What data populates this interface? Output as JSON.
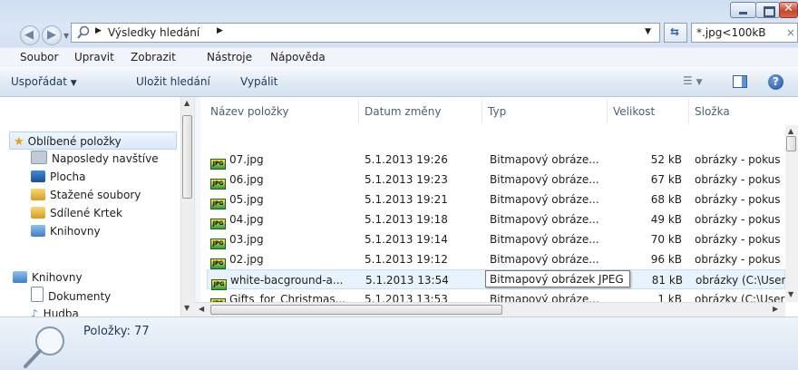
{
  "window": {
    "breadcrumb": "Výsledky hledání",
    "search_value": "*.jpg<100kB"
  },
  "menu": [
    "Soubor",
    "Upravit",
    "Zobrazit",
    "Nástroje",
    "Nápověda"
  ],
  "commands": {
    "organize": "Uspořádat",
    "save_search": "Uložit hledání",
    "burn": "Vypálit"
  },
  "nav": {
    "favorites": "Oblíbené položky",
    "fav_items": [
      "Naposledy navštíve",
      "Plocha",
      "Stažené soubory",
      "Sdílené Krtek",
      "Knihovny"
    ],
    "libraries": "Knihovny",
    "lib_items": [
      "Dokumenty",
      "Hudba"
    ]
  },
  "columns": [
    "Název položky",
    "Datum změny",
    "Typ",
    "Velikost",
    "Složka"
  ],
  "rows": [
    {
      "name": "07.jpg",
      "date": "5.1.2013 19:26",
      "type": "Bitmapový obráze...",
      "size": "52 kB",
      "folder": "obrázky - pokus"
    },
    {
      "name": "06.jpg",
      "date": "5.1.2013 19:23",
      "type": "Bitmapový obráze...",
      "size": "67 kB",
      "folder": "obrázky - pokus"
    },
    {
      "name": "05.jpg",
      "date": "5.1.2013 19:21",
      "type": "Bitmapový obráze...",
      "size": "68 kB",
      "folder": "obrázky - pokus"
    },
    {
      "name": "04.jpg",
      "date": "5.1.2013 19:18",
      "type": "Bitmapový obráze...",
      "size": "49 kB",
      "folder": "obrázky - pokus"
    },
    {
      "name": "03.jpg",
      "date": "5.1.2013 19:14",
      "type": "Bitmapový obráze...",
      "size": "70 kB",
      "folder": "obrázky - pokus"
    },
    {
      "name": "02.jpg",
      "date": "5.1.2013 19:12",
      "type": "Bitmapový obráze...",
      "size": "96 kB",
      "folder": "obrázky - pokus"
    },
    {
      "name": "white-bacground-a...",
      "date": "5.1.2013 13:54",
      "type": "Bitmapový obráze...",
      "size": "81 kB",
      "folder": "obrázky (C:\\User"
    },
    {
      "name": "Gifts_for_Christmas...",
      "date": "5.1.2013 13:53",
      "type": "Bitmapový obráze...",
      "size": "1 kB",
      "folder": "obrázky (C:\\User"
    }
  ],
  "file_icon_text": "JPG",
  "tooltip": "Bitmapový obrázek JPEG",
  "status": "Položky: 77",
  "colors": {
    "close": "#c9462c",
    "hover_row": "#e5f1fb"
  },
  "icons": [
    "back-arrow-icon",
    "forward-arrow-icon",
    "search-icon",
    "refresh-icon",
    "preview-pane-icon",
    "help-icon",
    "star-icon",
    "folder-icon",
    "jpg-file-icon",
    "magnifier-large-icon"
  ]
}
